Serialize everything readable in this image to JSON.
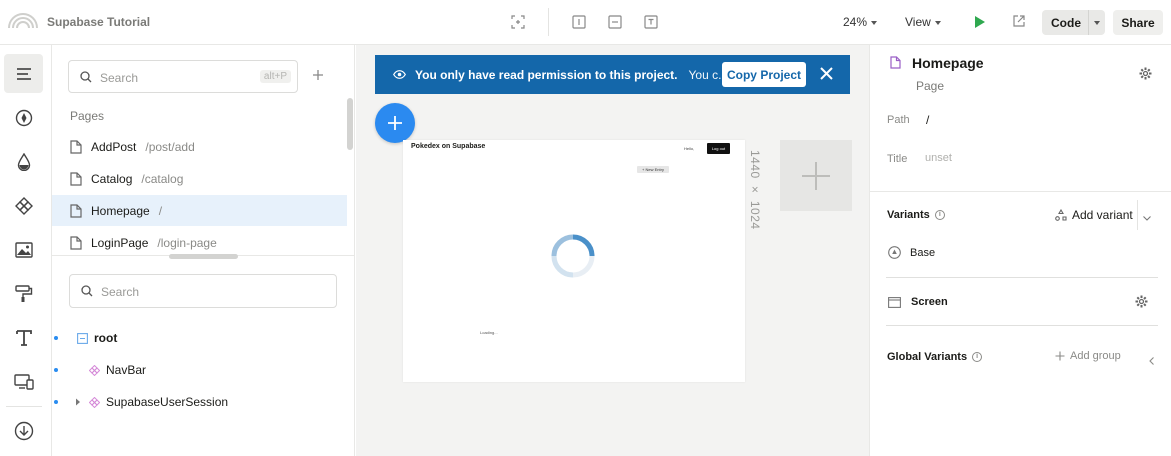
{
  "app": {
    "project_title": "Supabase Tutorial"
  },
  "toolbar": {
    "zoom": "24%",
    "view_label": "View",
    "code_label": "Code",
    "share_label": "Share"
  },
  "left_panel": {
    "search_placeholder": "Search",
    "search_shortcut": "alt+P",
    "pages_heading": "Pages",
    "pages": [
      {
        "name": "AddPost",
        "path": "/post/add"
      },
      {
        "name": "Catalog",
        "path": "/catalog"
      },
      {
        "name": "Homepage",
        "path": "/"
      },
      {
        "name": "LoginPage",
        "path": "/login-page"
      }
    ],
    "selected_page_index": 2,
    "tree_search_placeholder": "Search",
    "tree": [
      {
        "label": "root",
        "bold": true
      },
      {
        "label": "NavBar",
        "bold": false
      },
      {
        "label": "SupabaseUserSession",
        "bold": false
      }
    ]
  },
  "canvas": {
    "banner_text": "You only have read permission to this project.",
    "banner_more": "You c...",
    "copy_button": "Copy Project",
    "artboard": {
      "title": "Pokedex on Supabase",
      "hello": "Hello,",
      "logout": "Log out",
      "new_entry": "+ New Entry",
      "loading": "Loading..."
    },
    "artboard_size": "1440 × 1024"
  },
  "right_panel": {
    "title": "Homepage",
    "subtitle": "Page",
    "path_label": "Path",
    "path_value": "/",
    "title_label": "Title",
    "title_value": "unset",
    "variants_heading": "Variants",
    "add_variant": "Add variant",
    "base_label": "Base",
    "screen_label": "Screen",
    "global_variants_heading": "Global Variants",
    "add_group": "Add group"
  },
  "colors": {
    "banner": "#1467aa",
    "accent_blue": "#2b8af0",
    "selected_row": "#e7f1fb",
    "play_green": "#2fa84f"
  },
  "icons": [
    "supabase-logo-icon",
    "fullscreen-icon",
    "insert-icon",
    "tablet-icon",
    "text-icon",
    "play-icon",
    "external-link-icon",
    "chevron-down-icon",
    "menu-icon",
    "compass-icon",
    "drop-icon",
    "component-icon",
    "image-icon",
    "paint-roller-icon",
    "text-tool-icon",
    "responsive-icon",
    "download-icon",
    "search-icon",
    "plus-icon",
    "page-icon",
    "eye-icon",
    "close-icon",
    "gear-icon",
    "info-icon",
    "variant-icon",
    "screen-icon"
  ]
}
